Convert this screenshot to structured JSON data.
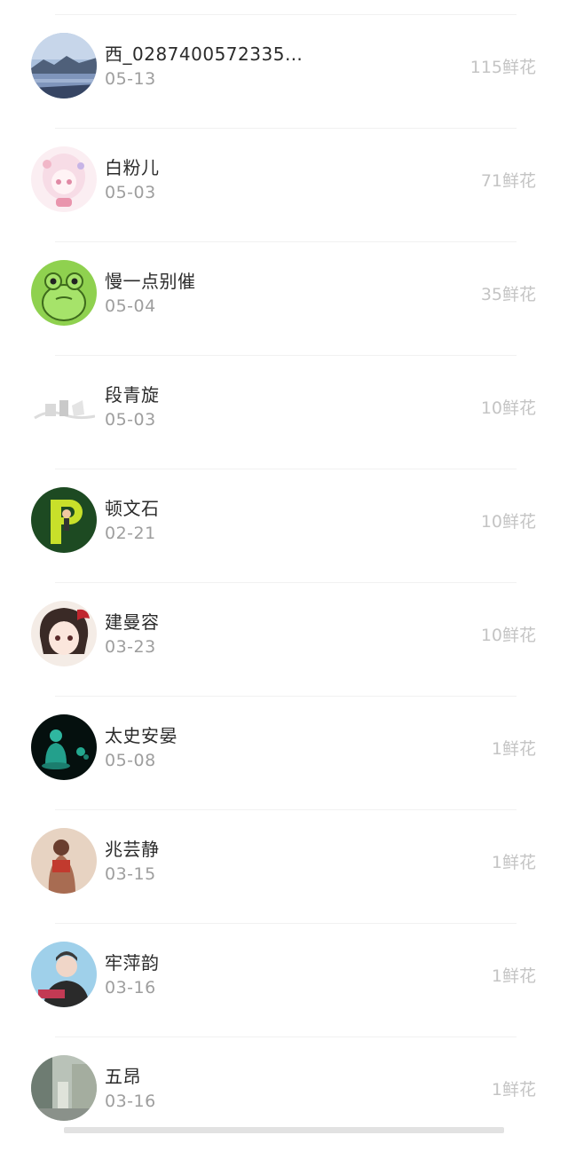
{
  "list": {
    "items": [
      {
        "name": "西_02874005723354…",
        "date": "05-13",
        "flowers": "115鲜花"
      },
      {
        "name": "白粉儿",
        "date": "05-03",
        "flowers": "71鲜花"
      },
      {
        "name": "慢一点别催",
        "date": "05-04",
        "flowers": "35鲜花"
      },
      {
        "name": "段青旋",
        "date": "05-03",
        "flowers": "10鲜花"
      },
      {
        "name": "顿文石",
        "date": "02-21",
        "flowers": "10鲜花"
      },
      {
        "name": "建曼容",
        "date": "03-23",
        "flowers": "10鲜花"
      },
      {
        "name": "太史安晏",
        "date": "05-08",
        "flowers": "1鲜花"
      },
      {
        "name": "兆芸静",
        "date": "03-15",
        "flowers": "1鲜花"
      },
      {
        "name": "牢萍韵",
        "date": "03-16",
        "flowers": "1鲜花"
      },
      {
        "name": "五昂",
        "date": "03-16",
        "flowers": "1鲜花"
      }
    ]
  },
  "colors": {
    "name_text": "#2b2b2b",
    "date_text": "#9e9e9e",
    "flowers_text": "#c4c4c4",
    "divider": "#f1f1f1"
  }
}
